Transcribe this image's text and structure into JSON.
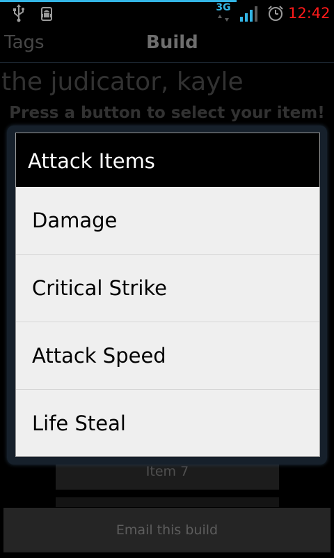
{
  "status_bar": {
    "network_type": "3G",
    "clock": "12:42",
    "accent_color": "#33b5e5",
    "clock_color": "#ff1a1a",
    "icons": [
      "usb-icon",
      "debug-icon",
      "signal-icon",
      "alarm-icon"
    ]
  },
  "tabs": [
    {
      "label": "Tags",
      "active": false
    },
    {
      "label": "Build",
      "active": true
    }
  ],
  "page": {
    "champion_name": "the judicator, kayle",
    "instruction": "Press a button to select your item!",
    "item_7_label": "Item 7",
    "email_label": "Email this build"
  },
  "dialog": {
    "title": "Attack Items",
    "options": [
      "Damage",
      "Critical Strike",
      "Attack Speed",
      "Life Steal"
    ]
  }
}
